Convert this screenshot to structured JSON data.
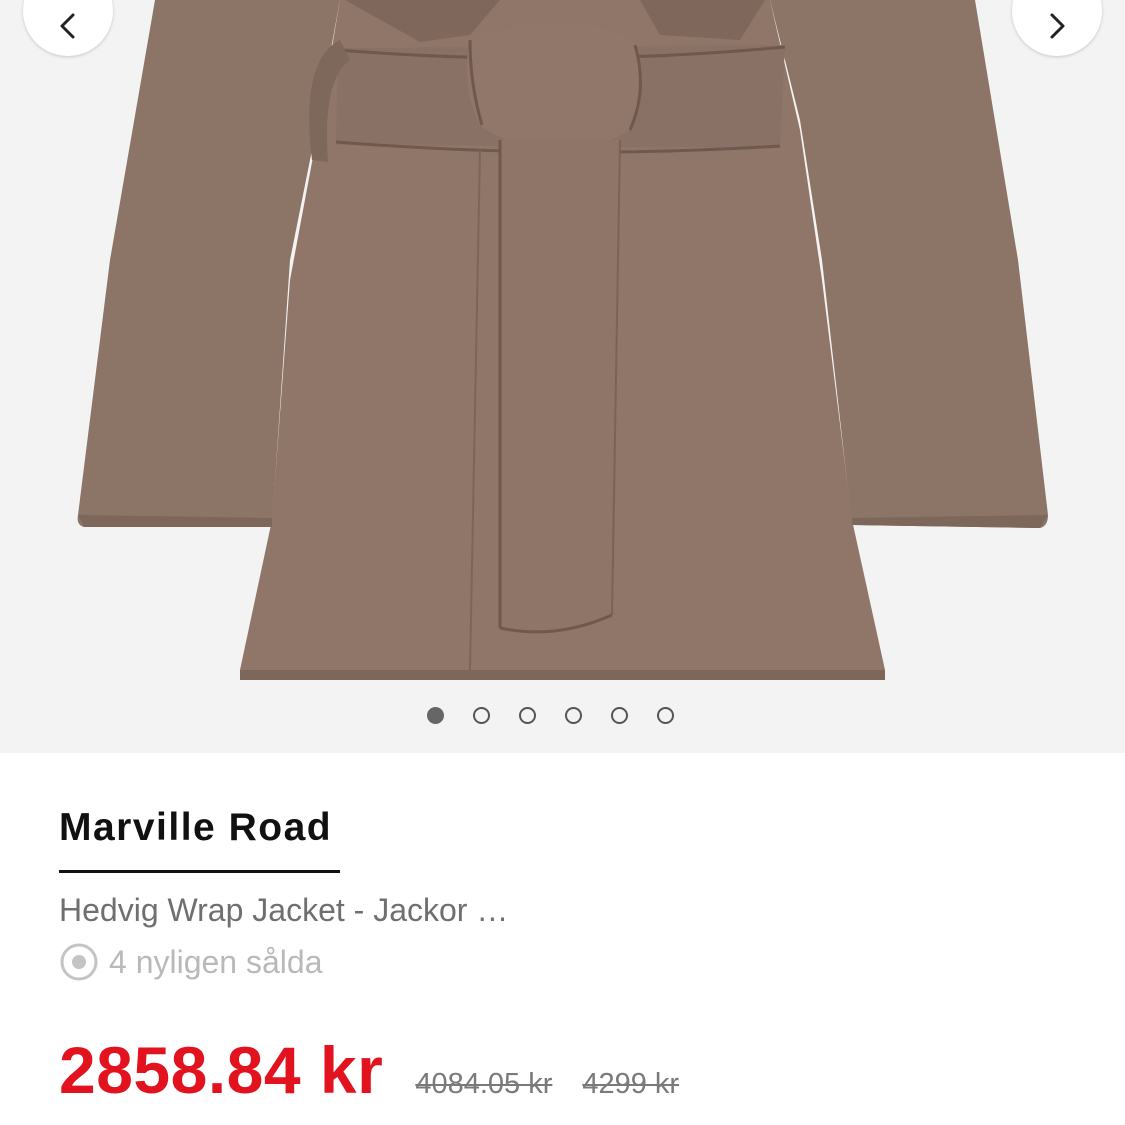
{
  "gallery": {
    "prev_icon": "chevron-left-icon",
    "next_icon": "chevron-right-icon",
    "image_count": 6,
    "active_index": 0,
    "background": "#f3f3f3",
    "garment_color": "#8c7467"
  },
  "product": {
    "brand": "Marville Road",
    "name": "Hedvig Wrap Jacket - Jackor …",
    "sold_icon": "target-icon",
    "sold_text": "4 nyligen sålda"
  },
  "price": {
    "current": "2858.84 kr",
    "original_1": "4084.05 kr",
    "original_2": "4299 kr",
    "accent_color": "#e3121f"
  }
}
